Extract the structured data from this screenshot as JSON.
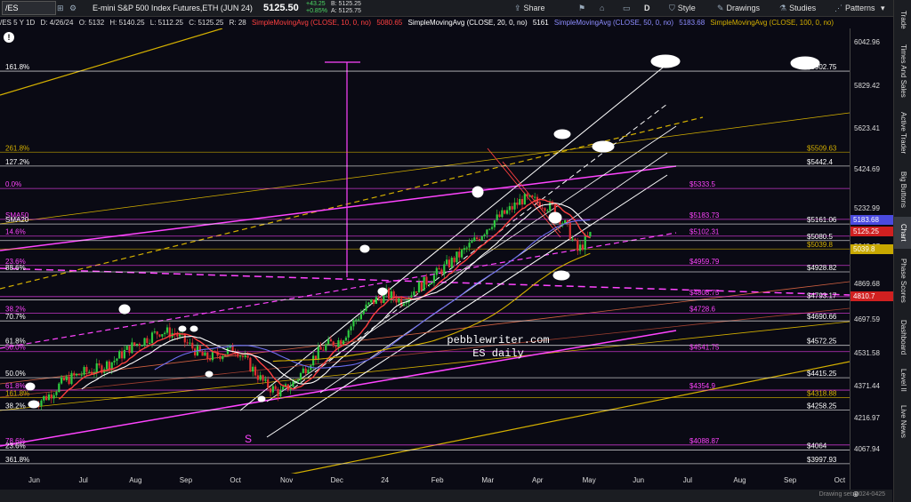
{
  "toolbar": {
    "symbol": "/ES",
    "instrument": "E-mini S&P 500 Index Futures,ETH (JUN 24)",
    "last": "5125.50",
    "change": "+43.25",
    "change_pct": "+0.85%",
    "bid": "B: 5125.25",
    "ask": "A: 5125.75",
    "share": "Share",
    "period": "D",
    "style": "Style",
    "drawings": "Drawings",
    "studies": "Studies",
    "patterns": "Patterns"
  },
  "inforow": {
    "period": "/ES 5 Y 1D",
    "date": "D: 4/26/24",
    "open": "O: 5132",
    "high": "H: 5140.25",
    "low": "L: 5112.25",
    "close": "C: 5125.25",
    "range": "R: 28",
    "sma10": "SimpleMovingAvg (CLOSE, 10, 0, no)",
    "sma10_val": "5080.65",
    "sma20": "SimpleMovingAvg (CLOSE, 20, 0, no)",
    "sma20_val": "5161",
    "sma50": "SimpleMovingAvg (CLOSE, 50, 0, no)",
    "sma50_val": "5183.68",
    "sma100": "SimpleMovingAvg (CLOSE, 100, 0, no)"
  },
  "colors": {
    "background": "#0a0a14",
    "candle_up": "#2ecc40",
    "candle_down": "#e03030",
    "sma10": "#ff4040",
    "sma20": "#ffffff",
    "sma50": "#6d6df0",
    "sma100": "#d4b000",
    "magenta": "#ff44ff",
    "gold": "#d4b000"
  },
  "chart_data": {
    "type": "candlestick",
    "title": "",
    "xlabel": "",
    "ylabel": "",
    "ylim": [
      3950,
      6110
    ],
    "x_ticks": [
      "Jun",
      "Jul",
      "Aug",
      "Sep",
      "Oct",
      "Nov",
      "Dec",
      "24",
      "Feb",
      "Mar",
      "Apr",
      "May",
      "Jun",
      "Jul",
      "Aug",
      "Sep",
      "Oct"
    ],
    "y_ticks": [
      "6042.96",
      "5829.42",
      "5623.41",
      "5424.69",
      "5232.99",
      "5048.67",
      "4869.68",
      "4697.59",
      "4531.58",
      "4371.44",
      "4216.97",
      "4067.94"
    ],
    "price_badges": [
      {
        "label": "5183.68",
        "value": 5183.68,
        "color": "#4a4adf"
      },
      {
        "label": "5125.25",
        "value": 5125.25,
        "color": "#d02020"
      },
      {
        "label": "5039.8",
        "value": 5039.8,
        "color": "#c8a800"
      },
      {
        "label": "4810.7",
        "value": 4810.7,
        "color": "#d02020"
      }
    ],
    "levels": [
      {
        "label": "$5902.75",
        "value": 5902.75,
        "color": "#ffffff"
      },
      {
        "label": "$5509.63",
        "value": 5509.63,
        "color": "#d4b000"
      },
      {
        "label": "$5442.4",
        "value": 5442.4,
        "color": "#ffffff"
      },
      {
        "label": "$5333.5",
        "value": 5333.5,
        "color": "#ff44ff"
      },
      {
        "label": "$5183.73",
        "value": 5183.73,
        "color": "#ff44ff"
      },
      {
        "label": "$5161.06",
        "value": 5161.06,
        "color": "#ffffff"
      },
      {
        "label": "$5102.31",
        "value": 5102.31,
        "color": "#ff44ff"
      },
      {
        "label": "$5080.5",
        "value": 5080.5,
        "color": "#ffffff"
      },
      {
        "label": "$5039.8",
        "value": 5039.8,
        "color": "#d4b000"
      },
      {
        "label": "$4959.79",
        "value": 4959.79,
        "color": "#ff44ff"
      },
      {
        "label": "$4928.82",
        "value": 4928.82,
        "color": "#ffffff"
      },
      {
        "label": "$4808.75",
        "value": 4808.75,
        "color": "#ff44ff"
      },
      {
        "label": "$4793.17",
        "value": 4793.17,
        "color": "#ffffff"
      },
      {
        "label": "$4728.6",
        "value": 4728.6,
        "color": "#ff44ff"
      },
      {
        "label": "$4690.66",
        "value": 4690.66,
        "color": "#ffffff"
      },
      {
        "label": "$4572.25",
        "value": 4572.25,
        "color": "#ffffff"
      },
      {
        "label": "$4541.75",
        "value": 4541.75,
        "color": "#ff44ff"
      },
      {
        "label": "$4415.25",
        "value": 4415.25,
        "color": "#ffffff"
      },
      {
        "label": "$4354.9",
        "value": 4354.9,
        "color": "#ff44ff"
      },
      {
        "label": "$4318.88",
        "value": 4318.88,
        "color": "#d4b000"
      },
      {
        "label": "$4258.25",
        "value": 4258.25,
        "color": "#ffffff"
      },
      {
        "label": "$4088.87",
        "value": 4088.87,
        "color": "#ff44ff"
      },
      {
        "label": "$4064",
        "value": 4064,
        "color": "#ffffff"
      },
      {
        "label": "$3997.93",
        "value": 3997.93,
        "color": "#ffffff"
      }
    ],
    "fib_labels_left": [
      {
        "label": "161.8%",
        "value": 5902.75,
        "color": "#ffffff"
      },
      {
        "label": "261.8%",
        "value": 5509.63,
        "color": "#d4b000"
      },
      {
        "label": "127.2%",
        "value": 5442.4,
        "color": "#ffffff"
      },
      {
        "label": "0.0%",
        "value": 5333.5,
        "color": "#ff44ff"
      },
      {
        "label": "SMA50",
        "value": 5183.73,
        "color": "#ff44ff"
      },
      {
        "label": "SMA20",
        "value": 5161.06,
        "color": "#ffffff"
      },
      {
        "label": "14.6%",
        "value": 5102.31,
        "color": "#ff44ff"
      },
      {
        "label": "23.6%",
        "value": 4959.79,
        "color": "#ff44ff"
      },
      {
        "label": "88.6%",
        "value": 4928.82,
        "color": "#ffffff"
      },
      {
        "label": "38.2%",
        "value": 4728.6,
        "color": "#ff44ff"
      },
      {
        "label": "70.7%",
        "value": 4690.66,
        "color": "#ffffff"
      },
      {
        "label": "61.8%",
        "value": 4572.25,
        "color": "#ffffff"
      },
      {
        "label": "50.0%",
        "value": 4541.75,
        "color": "#ff44ff"
      },
      {
        "label": "50.0%",
        "value": 4415.25,
        "color": "#ffffff"
      },
      {
        "label": "61.8%",
        "value": 4354.9,
        "color": "#ff44ff"
      },
      {
        "label": "161.8%",
        "value": 4318.88,
        "color": "#d4b000"
      },
      {
        "label": "38.2%",
        "value": 4258.25,
        "color": "#ffffff"
      },
      {
        "label": "78.6%",
        "value": 4088.87,
        "color": "#ff44ff"
      },
      {
        "label": "23.6%",
        "value": 4064,
        "color": "#ffffff"
      },
      {
        "label": "361.8%",
        "value": 3997.93,
        "color": "#ffffff"
      }
    ],
    "price_path": [
      {
        "m": 0.0,
        "p": 4290
      },
      {
        "m": 0.3,
        "p": 4330
      },
      {
        "m": 0.6,
        "p": 4400
      },
      {
        "m": 1.0,
        "p": 4440
      },
      {
        "m": 1.3,
        "p": 4460
      },
      {
        "m": 1.6,
        "p": 4500
      },
      {
        "m": 1.9,
        "p": 4560
      },
      {
        "m": 2.2,
        "p": 4600
      },
      {
        "m": 2.5,
        "p": 4640
      },
      {
        "m": 2.8,
        "p": 4630
      },
      {
        "m": 3.1,
        "p": 4570
      },
      {
        "m": 3.4,
        "p": 4510
      },
      {
        "m": 3.7,
        "p": 4530
      },
      {
        "m": 4.0,
        "p": 4560
      },
      {
        "m": 4.3,
        "p": 4470
      },
      {
        "m": 4.6,
        "p": 4380
      },
      {
        "m": 4.9,
        "p": 4340
      },
      {
        "m": 5.2,
        "p": 4400
      },
      {
        "m": 5.5,
        "p": 4500
      },
      {
        "m": 5.8,
        "p": 4570
      },
      {
        "m": 6.1,
        "p": 4600
      },
      {
        "m": 6.4,
        "p": 4700
      },
      {
        "m": 6.7,
        "p": 4780
      },
      {
        "m": 7.0,
        "p": 4820
      },
      {
        "m": 7.3,
        "p": 4790
      },
      {
        "m": 7.6,
        "p": 4850
      },
      {
        "m": 7.9,
        "p": 4900
      },
      {
        "m": 8.2,
        "p": 4960
      },
      {
        "m": 8.5,
        "p": 5020
      },
      {
        "m": 8.8,
        "p": 5090
      },
      {
        "m": 9.1,
        "p": 5170
      },
      {
        "m": 9.4,
        "p": 5220
      },
      {
        "m": 9.7,
        "p": 5280
      },
      {
        "m": 10.0,
        "p": 5270
      },
      {
        "m": 10.3,
        "p": 5240
      },
      {
        "m": 10.6,
        "p": 5140
      },
      {
        "m": 10.8,
        "p": 5030
      },
      {
        "m": 11.0,
        "p": 5090
      },
      {
        "m": 11.1,
        "p": 5125
      }
    ],
    "series": [
      {
        "name": "SMA10",
        "color": "#ff4040"
      },
      {
        "name": "SMA20",
        "color": "#ffffff"
      },
      {
        "name": "SMA50",
        "color": "#6d6df0"
      },
      {
        "name": "SMA100",
        "color": "#d4b000"
      }
    ],
    "watermark_line1": "pebblewriter.com",
    "watermark_line2": "ES daily",
    "annotation_s": "S"
  },
  "sidetabs": [
    "Trade",
    "Times And Sales",
    "Active Trader",
    "Big Buttons",
    "Chart",
    "Phase Scores",
    "Dashboard",
    "Level II",
    "Live News"
  ],
  "bottombar": {
    "drawing_set": "Drawing set: 2024-0425"
  }
}
